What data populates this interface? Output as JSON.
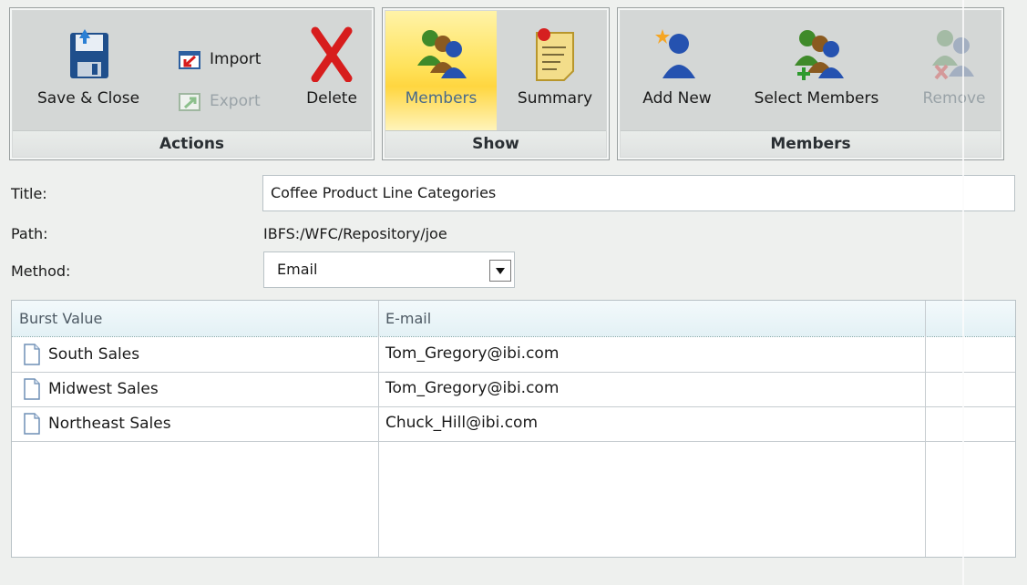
{
  "ribbon": {
    "actions": {
      "caption": "Actions",
      "save_close": "Save & Close",
      "import": "Import",
      "export": "Export",
      "delete": "Delete"
    },
    "show": {
      "caption": "Show",
      "members": "Members",
      "summary": "Summary"
    },
    "members_group": {
      "caption": "Members",
      "add_new": "Add New",
      "select_members": "Select Members",
      "remove": "Remove"
    }
  },
  "form": {
    "title_label": "Title:",
    "title_value": "Coffee Product Line Categories",
    "path_label": "Path:",
    "path_value": "IBFS:/WFC/Repository/joe",
    "method_label": "Method:",
    "method_value": "Email"
  },
  "grid": {
    "columns": [
      "Burst Value",
      "E-mail",
      ""
    ],
    "rows": [
      {
        "burst": "South Sales",
        "email": "Tom_Gregory@ibi.com"
      },
      {
        "burst": "Midwest Sales",
        "email": "Tom_Gregory@ibi.com"
      },
      {
        "burst": "Northeast Sales",
        "email": "Chuck_Hill@ibi.com"
      }
    ]
  },
  "icons": {
    "save": "floppy-disk-icon",
    "import": "import-icon",
    "export": "export-icon",
    "delete": "red-x-icon",
    "members": "group-people-icon",
    "summary": "notepad-icon",
    "add_new": "person-add-icon",
    "select_members": "group-add-icon",
    "remove": "group-remove-icon",
    "row": "document-icon"
  },
  "colors": {
    "active_tab": "#ffd640",
    "ribbon_bg": "#d4d7d6",
    "grid_header": "#e3f1f5"
  }
}
